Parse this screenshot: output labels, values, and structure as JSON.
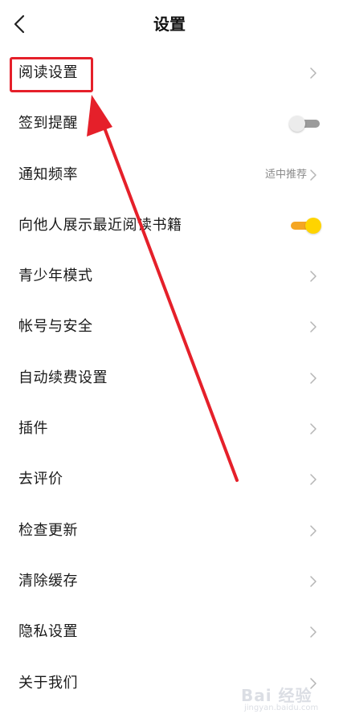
{
  "header": {
    "title": "设置",
    "back_icon": "chevron-left-icon"
  },
  "settings": [
    {
      "label": "阅读设置",
      "control": "chevron"
    },
    {
      "label": "签到提醒",
      "control": "toggle",
      "on": false
    },
    {
      "label": "通知频率",
      "control": "chevron",
      "value": "适中推荐"
    },
    {
      "label": "向他人展示最近阅读书籍",
      "control": "toggle",
      "on": true
    },
    {
      "label": "青少年模式",
      "control": "chevron"
    },
    {
      "label": "帐号与安全",
      "control": "chevron"
    },
    {
      "label": "自动续费设置",
      "control": "chevron"
    },
    {
      "label": "插件",
      "control": "chevron"
    },
    {
      "label": "去评价",
      "control": "chevron"
    },
    {
      "label": "检查更新",
      "control": "chevron"
    },
    {
      "label": "清除缓存",
      "control": "chevron"
    },
    {
      "label": "隐私设置",
      "control": "chevron"
    },
    {
      "label": "关于我们",
      "control": "chevron"
    }
  ],
  "annotation": {
    "color": "#e5202a"
  },
  "colors": {
    "toggle_on_track": "#f5a623",
    "toggle_on_knob": "#ffd400",
    "toggle_off_track": "#9b9b9b"
  },
  "watermark": {
    "text": "Bai  经验",
    "sub": "jingyan.baidu.com"
  }
}
